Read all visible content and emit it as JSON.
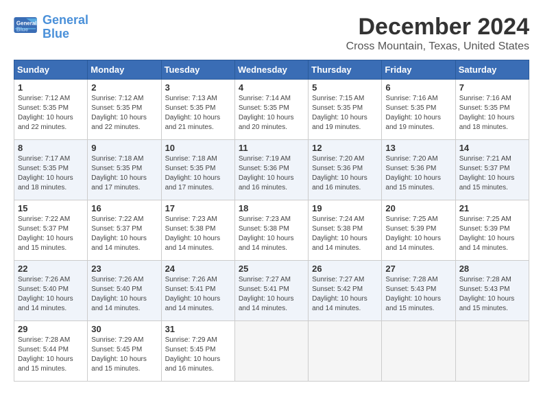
{
  "logo": {
    "line1": "General",
    "line2": "Blue"
  },
  "title": "December 2024",
  "location": "Cross Mountain, Texas, United States",
  "days_of_week": [
    "Sunday",
    "Monday",
    "Tuesday",
    "Wednesday",
    "Thursday",
    "Friday",
    "Saturday"
  ],
  "weeks": [
    [
      {
        "day": "1",
        "rise": "Sunrise: 7:12 AM",
        "set": "Sunset: 5:35 PM",
        "daylight": "Daylight: 10 hours and 22 minutes."
      },
      {
        "day": "2",
        "rise": "Sunrise: 7:12 AM",
        "set": "Sunset: 5:35 PM",
        "daylight": "Daylight: 10 hours and 22 minutes."
      },
      {
        "day": "3",
        "rise": "Sunrise: 7:13 AM",
        "set": "Sunset: 5:35 PM",
        "daylight": "Daylight: 10 hours and 21 minutes."
      },
      {
        "day": "4",
        "rise": "Sunrise: 7:14 AM",
        "set": "Sunset: 5:35 PM",
        "daylight": "Daylight: 10 hours and 20 minutes."
      },
      {
        "day": "5",
        "rise": "Sunrise: 7:15 AM",
        "set": "Sunset: 5:35 PM",
        "daylight": "Daylight: 10 hours and 19 minutes."
      },
      {
        "day": "6",
        "rise": "Sunrise: 7:16 AM",
        "set": "Sunset: 5:35 PM",
        "daylight": "Daylight: 10 hours and 19 minutes."
      },
      {
        "day": "7",
        "rise": "Sunrise: 7:16 AM",
        "set": "Sunset: 5:35 PM",
        "daylight": "Daylight: 10 hours and 18 minutes."
      }
    ],
    [
      {
        "day": "8",
        "rise": "Sunrise: 7:17 AM",
        "set": "Sunset: 5:35 PM",
        "daylight": "Daylight: 10 hours and 18 minutes."
      },
      {
        "day": "9",
        "rise": "Sunrise: 7:18 AM",
        "set": "Sunset: 5:35 PM",
        "daylight": "Daylight: 10 hours and 17 minutes."
      },
      {
        "day": "10",
        "rise": "Sunrise: 7:18 AM",
        "set": "Sunset: 5:35 PM",
        "daylight": "Daylight: 10 hours and 17 minutes."
      },
      {
        "day": "11",
        "rise": "Sunrise: 7:19 AM",
        "set": "Sunset: 5:36 PM",
        "daylight": "Daylight: 10 hours and 16 minutes."
      },
      {
        "day": "12",
        "rise": "Sunrise: 7:20 AM",
        "set": "Sunset: 5:36 PM",
        "daylight": "Daylight: 10 hours and 16 minutes."
      },
      {
        "day": "13",
        "rise": "Sunrise: 7:20 AM",
        "set": "Sunset: 5:36 PM",
        "daylight": "Daylight: 10 hours and 15 minutes."
      },
      {
        "day": "14",
        "rise": "Sunrise: 7:21 AM",
        "set": "Sunset: 5:37 PM",
        "daylight": "Daylight: 10 hours and 15 minutes."
      }
    ],
    [
      {
        "day": "15",
        "rise": "Sunrise: 7:22 AM",
        "set": "Sunset: 5:37 PM",
        "daylight": "Daylight: 10 hours and 15 minutes."
      },
      {
        "day": "16",
        "rise": "Sunrise: 7:22 AM",
        "set": "Sunset: 5:37 PM",
        "daylight": "Daylight: 10 hours and 14 minutes."
      },
      {
        "day": "17",
        "rise": "Sunrise: 7:23 AM",
        "set": "Sunset: 5:38 PM",
        "daylight": "Daylight: 10 hours and 14 minutes."
      },
      {
        "day": "18",
        "rise": "Sunrise: 7:23 AM",
        "set": "Sunset: 5:38 PM",
        "daylight": "Daylight: 10 hours and 14 minutes."
      },
      {
        "day": "19",
        "rise": "Sunrise: 7:24 AM",
        "set": "Sunset: 5:38 PM",
        "daylight": "Daylight: 10 hours and 14 minutes."
      },
      {
        "day": "20",
        "rise": "Sunrise: 7:25 AM",
        "set": "Sunset: 5:39 PM",
        "daylight": "Daylight: 10 hours and 14 minutes."
      },
      {
        "day": "21",
        "rise": "Sunrise: 7:25 AM",
        "set": "Sunset: 5:39 PM",
        "daylight": "Daylight: 10 hours and 14 minutes."
      }
    ],
    [
      {
        "day": "22",
        "rise": "Sunrise: 7:26 AM",
        "set": "Sunset: 5:40 PM",
        "daylight": "Daylight: 10 hours and 14 minutes."
      },
      {
        "day": "23",
        "rise": "Sunrise: 7:26 AM",
        "set": "Sunset: 5:40 PM",
        "daylight": "Daylight: 10 hours and 14 minutes."
      },
      {
        "day": "24",
        "rise": "Sunrise: 7:26 AM",
        "set": "Sunset: 5:41 PM",
        "daylight": "Daylight: 10 hours and 14 minutes."
      },
      {
        "day": "25",
        "rise": "Sunrise: 7:27 AM",
        "set": "Sunset: 5:41 PM",
        "daylight": "Daylight: 10 hours and 14 minutes."
      },
      {
        "day": "26",
        "rise": "Sunrise: 7:27 AM",
        "set": "Sunset: 5:42 PM",
        "daylight": "Daylight: 10 hours and 14 minutes."
      },
      {
        "day": "27",
        "rise": "Sunrise: 7:28 AM",
        "set": "Sunset: 5:43 PM",
        "daylight": "Daylight: 10 hours and 15 minutes."
      },
      {
        "day": "28",
        "rise": "Sunrise: 7:28 AM",
        "set": "Sunset: 5:43 PM",
        "daylight": "Daylight: 10 hours and 15 minutes."
      }
    ],
    [
      {
        "day": "29",
        "rise": "Sunrise: 7:28 AM",
        "set": "Sunset: 5:44 PM",
        "daylight": "Daylight: 10 hours and 15 minutes."
      },
      {
        "day": "30",
        "rise": "Sunrise: 7:29 AM",
        "set": "Sunset: 5:45 PM",
        "daylight": "Daylight: 10 hours and 15 minutes."
      },
      {
        "day": "31",
        "rise": "Sunrise: 7:29 AM",
        "set": "Sunset: 5:45 PM",
        "daylight": "Daylight: 10 hours and 16 minutes."
      },
      null,
      null,
      null,
      null
    ]
  ]
}
